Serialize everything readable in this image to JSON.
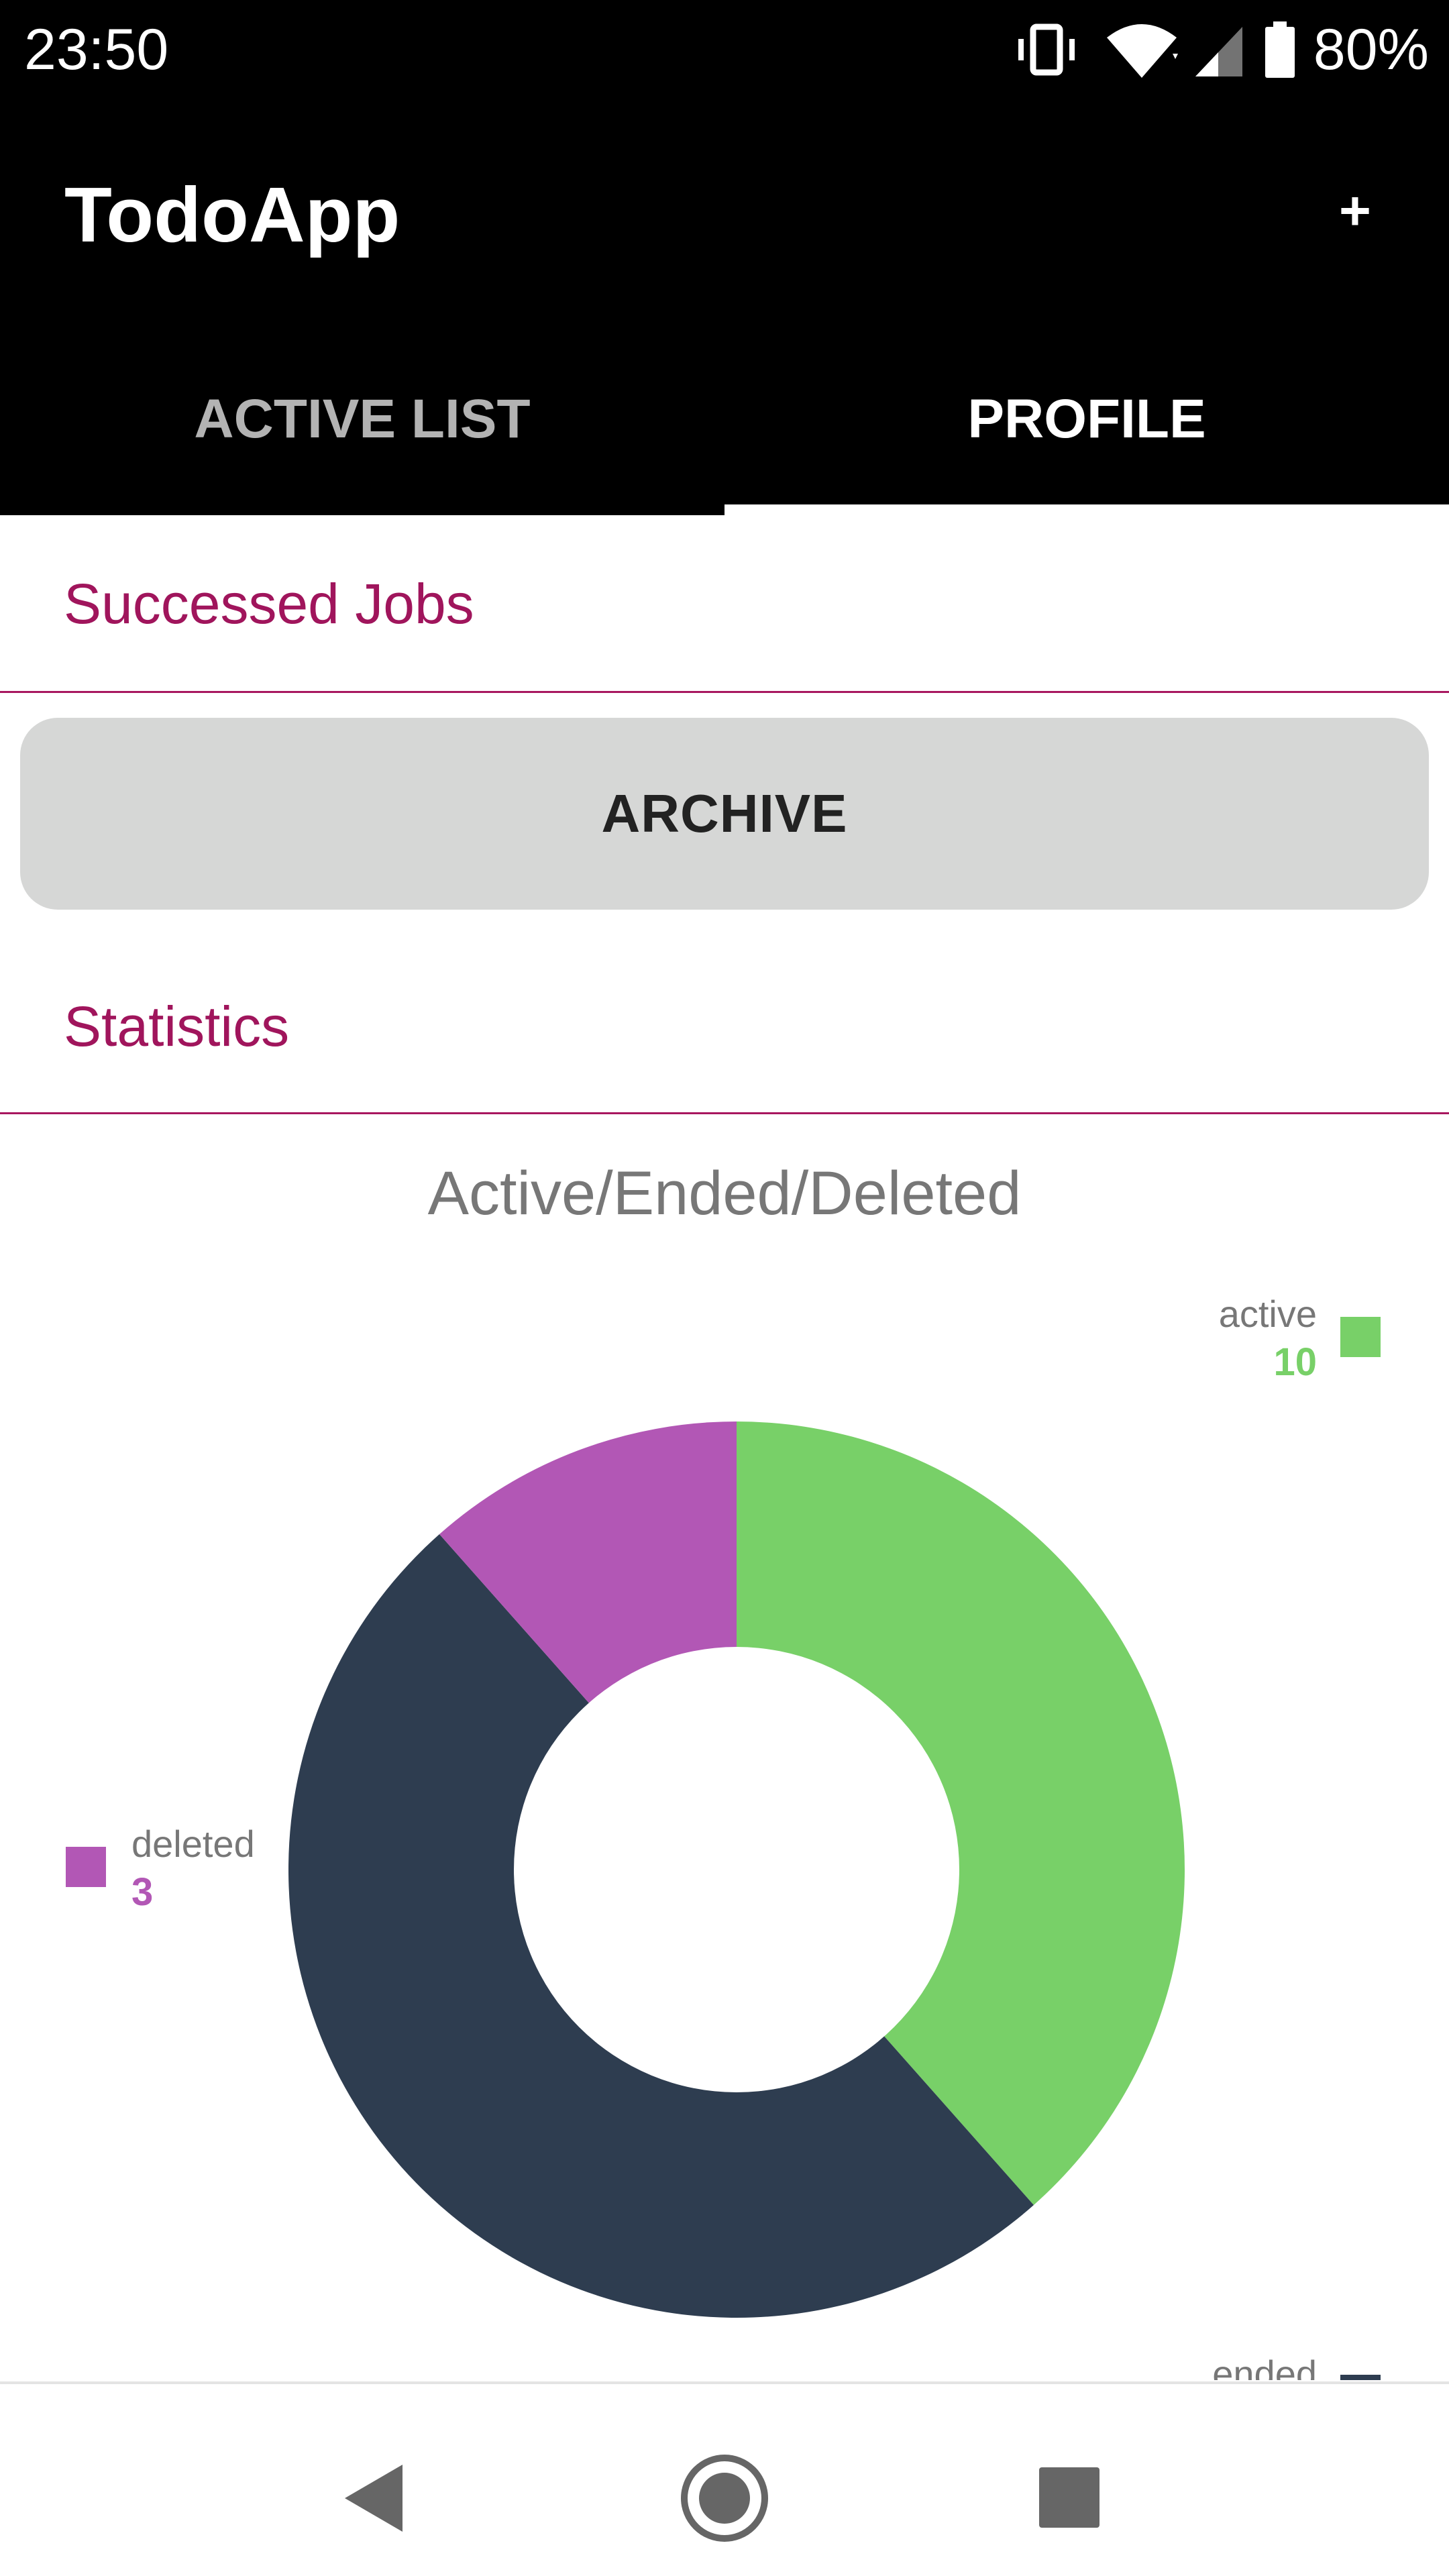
{
  "status_bar": {
    "time": "23:50",
    "battery": "80%",
    "icons": [
      "vibrate-icon",
      "wifi-icon",
      "signal-icon",
      "battery-icon"
    ]
  },
  "app_bar": {
    "title": "TodoApp",
    "add_label": "+",
    "tabs": [
      {
        "label": "ACTIVE LIST",
        "selected": false
      },
      {
        "label": "PROFILE",
        "selected": true
      }
    ]
  },
  "sections": {
    "successed_jobs": "Successed Jobs",
    "archive_button": "ARCHIVE",
    "statistics": "Statistics"
  },
  "colors": {
    "accent": "#a0155c",
    "active": "#78d068",
    "ended": "#2e3d50",
    "deleted": "#b257b5"
  },
  "chart_data": {
    "type": "pie",
    "title": "Active/Ended/Deleted",
    "donut": true,
    "categories": [
      "active",
      "ended",
      "deleted"
    ],
    "values": [
      10,
      13,
      3
    ],
    "value_labels": [
      "10",
      "",
      "3"
    ],
    "colors": [
      "#78d068",
      "#2e3d50",
      "#b257b5"
    ]
  },
  "nav_bar": {
    "icons": [
      "back-icon",
      "home-icon",
      "recent-apps-icon"
    ]
  }
}
